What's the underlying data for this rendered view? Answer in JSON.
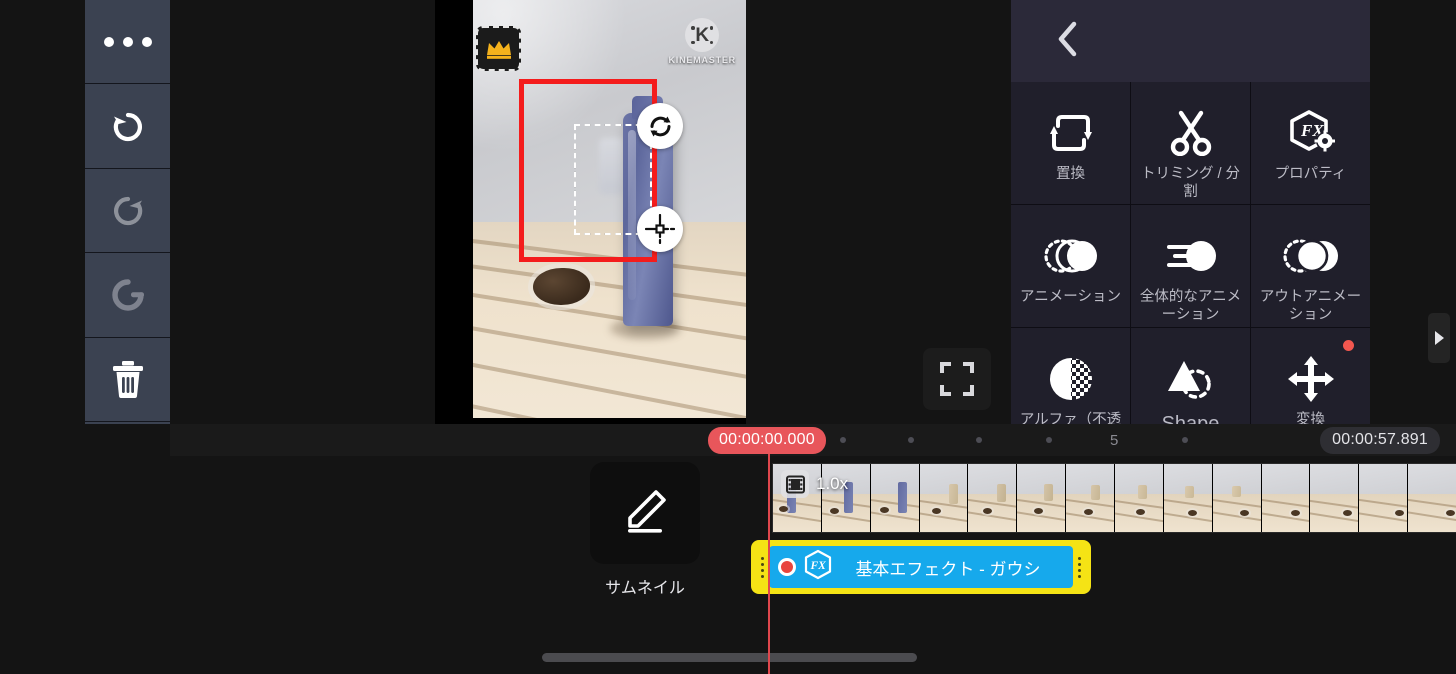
{
  "app": {
    "name": "KineMaster",
    "watermark_text": "KINEMASTER"
  },
  "toolbar": {
    "items": [
      {
        "name": "more-options",
        "icon": "ellipsis-icon",
        "enabled": true
      },
      {
        "name": "undo",
        "icon": "undo-icon",
        "enabled": true
      },
      {
        "name": "redo",
        "icon": "redo-icon",
        "enabled": false
      },
      {
        "name": "reset-rotate",
        "icon": "rotate-reset-icon",
        "enabled": true
      },
      {
        "name": "delete",
        "icon": "trash-icon",
        "enabled": true
      },
      {
        "name": "expand-track-height",
        "icon": "expand-vertical-icon",
        "enabled": true
      },
      {
        "name": "trim-to-left",
        "icon": "trim-left-icon",
        "enabled": true
      },
      {
        "name": "trim-to-right",
        "icon": "trim-right-icon",
        "enabled": true
      }
    ]
  },
  "preview": {
    "fullscreen_label": "fullscreen-icon",
    "crown_badge": "premium-crown-icon",
    "selection": {
      "rotate_handle": "rotate-handle-icon",
      "move_handle": "move-handle-icon",
      "box_color": "#f41c1c"
    }
  },
  "panel": {
    "back_label": "back-chevron-icon",
    "items": [
      {
        "label": "置換",
        "icon": "replace-icon",
        "badge": false,
        "latin": false
      },
      {
        "label": "トリミング / 分割",
        "icon": "scissors-icon",
        "badge": false,
        "latin": false
      },
      {
        "label": "プロパティ",
        "icon": "fx-properties-icon",
        "badge": false,
        "latin": false
      },
      {
        "label": "アニメーション",
        "icon": "in-animation-icon",
        "badge": false,
        "latin": false
      },
      {
        "label": "全体的なアニメーション",
        "icon": "overall-animation-icon",
        "badge": false,
        "latin": false
      },
      {
        "label": "アウトアニメーション",
        "icon": "out-animation-icon",
        "badge": false,
        "latin": false
      },
      {
        "label": "アルファ（不透明度）",
        "icon": "alpha-opacity-icon",
        "badge": false,
        "latin": false
      },
      {
        "label": "Shape",
        "icon": "shape-icon",
        "badge": false,
        "latin": true
      },
      {
        "label": "変換",
        "icon": "transform-icon",
        "badge": true,
        "latin": false
      }
    ]
  },
  "timeline": {
    "playhead_time": "00:00:00.000",
    "total_time": "00:00:57.891",
    "ruler_marks": [
      "5"
    ],
    "thumbnail_button": {
      "label": "サムネイル",
      "icon": "pencil-edit-icon"
    },
    "video_clip": {
      "speed": "1.0x",
      "speed_icon": "film-strip-icon"
    },
    "effect_clip": {
      "label": "基本エフェクト - ガウシ",
      "icon": "fx-hexagon-icon",
      "record_dot": "record-dot-icon",
      "bar_color": "#16a9ec",
      "frame_color": "#f5e315"
    }
  },
  "edge": {
    "flyout_icon": "play-triangle-icon"
  },
  "colors": {
    "app_bg": "#141414",
    "sidebar_btn": "#3b4251",
    "panel_bg": "#201f2b",
    "panel_header": "#2b2939",
    "accent_red": "#e8565b",
    "effect_yellow": "#f5e315",
    "effect_blue": "#16a9ec"
  }
}
